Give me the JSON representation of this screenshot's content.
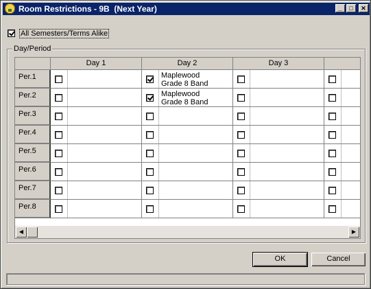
{
  "window": {
    "title": "Room Restrictions - 9B  (Next Year)",
    "minimize_icon": "minimize-icon",
    "maximize_icon": "maximize-icon",
    "close_icon": "close-icon"
  },
  "all_semesters": {
    "label": "All Semesters/Terms Alike",
    "checked": true
  },
  "group": {
    "label": "Day/Period"
  },
  "grid": {
    "columns": [
      "Day 1",
      "Day 2",
      "Day 3",
      ""
    ],
    "rows": [
      {
        "period": "Per.1",
        "cells": [
          {
            "checked": false,
            "text": ""
          },
          {
            "checked": true,
            "text": "Maplewood\nGrade 8 Band"
          },
          {
            "checked": false,
            "text": ""
          },
          {
            "checked": false,
            "text": ""
          }
        ]
      },
      {
        "period": "Per.2",
        "cells": [
          {
            "checked": false,
            "text": ""
          },
          {
            "checked": true,
            "text": "Maplewood\nGrade 8 Band"
          },
          {
            "checked": false,
            "text": ""
          },
          {
            "checked": false,
            "text": ""
          }
        ]
      },
      {
        "period": "Per.3",
        "cells": [
          {
            "checked": false,
            "text": ""
          },
          {
            "checked": false,
            "text": ""
          },
          {
            "checked": false,
            "text": ""
          },
          {
            "checked": false,
            "text": ""
          }
        ]
      },
      {
        "period": "Per.4",
        "cells": [
          {
            "checked": false,
            "text": ""
          },
          {
            "checked": false,
            "text": ""
          },
          {
            "checked": false,
            "text": ""
          },
          {
            "checked": false,
            "text": ""
          }
        ]
      },
      {
        "period": "Per.5",
        "cells": [
          {
            "checked": false,
            "text": ""
          },
          {
            "checked": false,
            "text": ""
          },
          {
            "checked": false,
            "text": ""
          },
          {
            "checked": false,
            "text": ""
          }
        ]
      },
      {
        "period": "Per.6",
        "cells": [
          {
            "checked": false,
            "text": ""
          },
          {
            "checked": false,
            "text": ""
          },
          {
            "checked": false,
            "text": ""
          },
          {
            "checked": false,
            "text": ""
          }
        ]
      },
      {
        "period": "Per.7",
        "cells": [
          {
            "checked": false,
            "text": ""
          },
          {
            "checked": false,
            "text": ""
          },
          {
            "checked": false,
            "text": ""
          },
          {
            "checked": false,
            "text": ""
          }
        ]
      },
      {
        "period": "Per.8",
        "cells": [
          {
            "checked": false,
            "text": ""
          },
          {
            "checked": false,
            "text": ""
          },
          {
            "checked": false,
            "text": ""
          },
          {
            "checked": false,
            "text": ""
          }
        ]
      }
    ]
  },
  "buttons": {
    "ok": "OK",
    "cancel": "Cancel"
  },
  "colors": {
    "titlebar": "#0a246a",
    "face": "#d4d0c8"
  }
}
